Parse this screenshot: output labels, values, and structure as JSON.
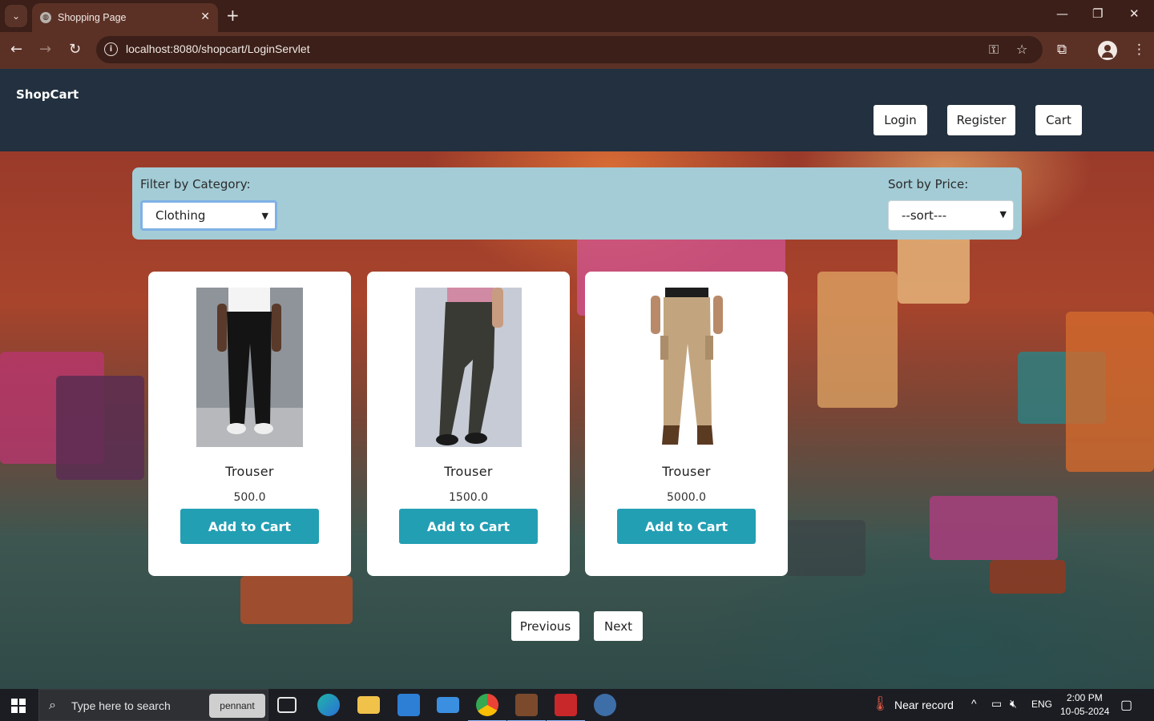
{
  "browser": {
    "tab_title": "Shopping Page",
    "new_tab_glyph": "+",
    "close_tab_glyph": "✕",
    "url": "localhost:8080/shopcart/LoginServlet",
    "window_controls": {
      "minimize": "—",
      "maximize": "❐",
      "close": "✕"
    }
  },
  "header": {
    "logo": "ShopCart",
    "buttons": {
      "login": "Login",
      "register": "Register",
      "cart": "Cart"
    }
  },
  "filters": {
    "category_label": "Filter by Category:",
    "category_value": "Clothing",
    "sort_label": "Sort by Price:",
    "sort_value": "--sort---"
  },
  "products": [
    {
      "name": "Trouser",
      "price": "500.0",
      "button": "Add to Cart",
      "pant_color": "#141414",
      "bg_color": "#8f949a"
    },
    {
      "name": "Trouser",
      "price": "1500.0",
      "button": "Add to Cart",
      "pant_color": "#3a3a34",
      "bg_color": "#c6cbd6"
    },
    {
      "name": "Trouser",
      "price": "5000.0",
      "button": "Add to Cart",
      "pant_color": "#c2a57f",
      "bg_color": "#ffffff"
    }
  ],
  "pagination": {
    "previous": "Previous",
    "next": "Next"
  },
  "taskbar": {
    "search_placeholder": "Type here to search",
    "pennant": "pennant",
    "weather": "Near record",
    "language": "ENG",
    "time": "2:00 PM",
    "date": "10-05-2024"
  },
  "colors": {
    "accent": "#239fb4",
    "header_bg": "#22303f",
    "filter_bg": "#a3ccd6"
  }
}
